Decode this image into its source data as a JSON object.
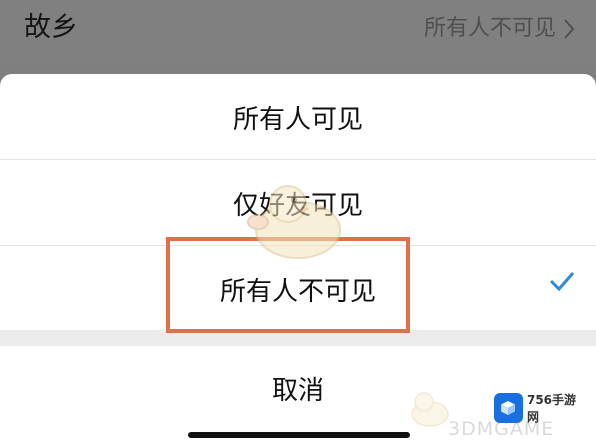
{
  "header": {
    "title": "故乡",
    "value": "所有人不可见"
  },
  "action_sheet": {
    "options": [
      {
        "label": "所有人可见"
      },
      {
        "label": "仅好友可见"
      },
      {
        "label": "所有人不可见",
        "selected": true
      }
    ],
    "cancel_label": "取消"
  },
  "watermark": {
    "logo_text": "756手游网",
    "site_text": "3DMGAME"
  },
  "colors": {
    "check": "#2f8bd8",
    "highlight_border": "#e0704a"
  }
}
